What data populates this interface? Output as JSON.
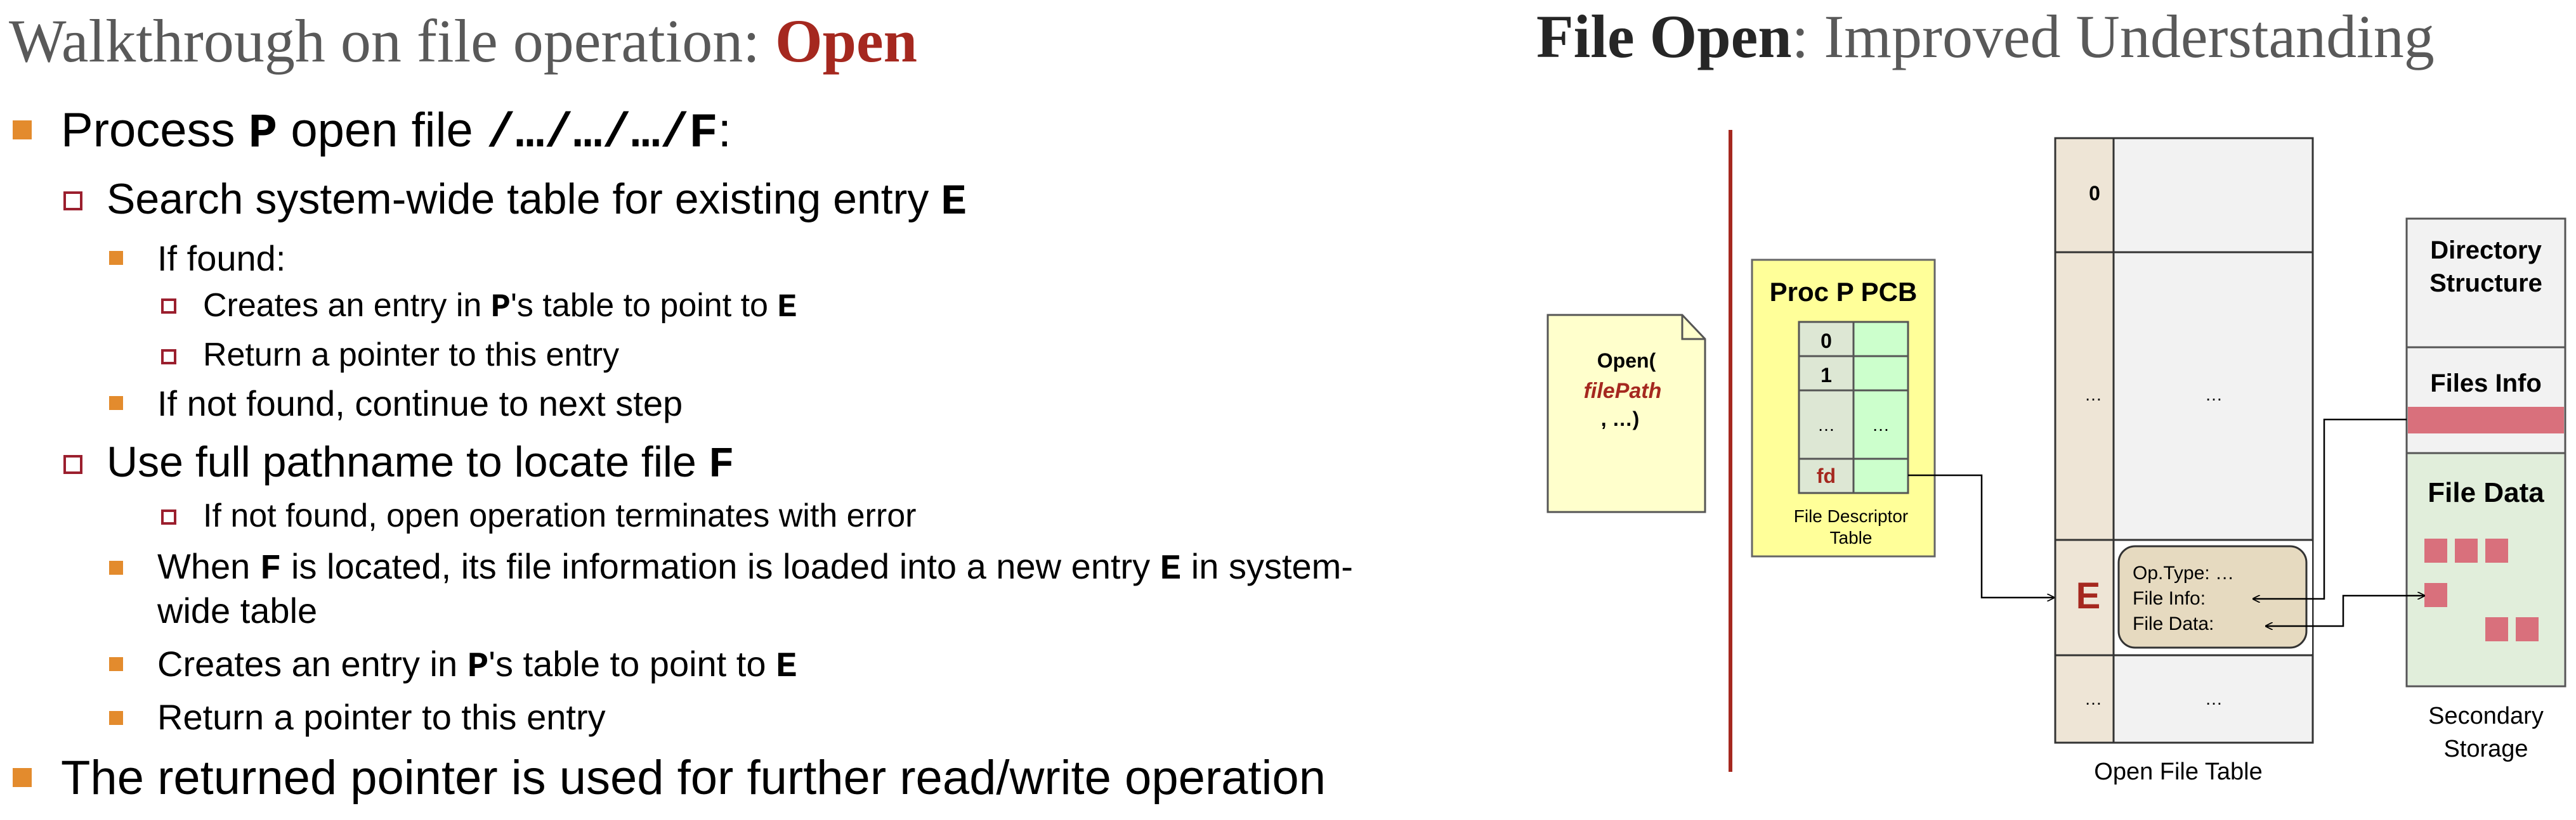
{
  "left": {
    "title_prefix": "Walkthrough on file operation: ",
    "title_accent": "Open",
    "bullets": {
      "b1_a": "Process ",
      "b1_p": "P",
      "b1_b": " open file ",
      "b1_path": "/…/…/…/F",
      "b1_c": ":",
      "b2_a": "Search system-wide table for existing entry ",
      "b2_e": "E",
      "b3": "If found:",
      "b4_a": "Creates an entry in ",
      "b4_p": "P",
      "b4_b": "'s table to point to ",
      "b4_e": "E",
      "b5": "Return a pointer to this entry",
      "b6": "If not found, continue to next step",
      "b7_a": "Use full pathname to locate file ",
      "b7_f": "F",
      "b8": "If not found, open operation terminates with error",
      "b9_a": "When ",
      "b9_f": "F",
      "b9_b": " is located, its file information is loaded into a new entry ",
      "b9_e": "E",
      "b9_c": " in system-",
      "b9_d": "wide table",
      "b10_a": "Creates an entry in ",
      "b10_p": "P",
      "b10_b": "'s table to point to ",
      "b10_e": "E",
      "b11": "Return a pointer to this entry",
      "b12": "The returned pointer is used for further read/write operation"
    }
  },
  "right": {
    "title_strong": "File Open",
    "title_rest": ": Improved Understanding",
    "diagram": {
      "call_open": "Open(",
      "call_arg": "filePath",
      "call_rest": ", …)",
      "pcb_title": "Proc P PCB",
      "fd_rows": [
        "0",
        "1",
        "…"
      ],
      "fd_row_right": "…",
      "fd_label": "fd",
      "fd_caption_1": "File Descriptor",
      "fd_caption_2": "Table",
      "oft_index": [
        "0",
        "…",
        "…"
      ],
      "oft_ellipsis": [
        "…",
        "…"
      ],
      "oft_entry_label": "E",
      "oft_fields": [
        "Op.Type: …",
        "File Info:",
        "File Data:"
      ],
      "oft_caption": "Open File Table",
      "storage_sections": [
        "Directory",
        "Structure",
        "Files Info",
        "File Data"
      ],
      "storage_caption_1": "Secondary",
      "storage_caption_2": "Storage"
    },
    "colors": {
      "accent_red": "#a5281f",
      "pcb_yellow": "#ffff99",
      "note_yellow": "#ffffcc",
      "fd_green": "#ccffcc",
      "oft_beige": "#eee5d6",
      "entry_tan": "#e6dac0",
      "storage_green": "#e1eedb",
      "block_pink": "#d9707c",
      "divider_red": "#a5281f"
    }
  }
}
